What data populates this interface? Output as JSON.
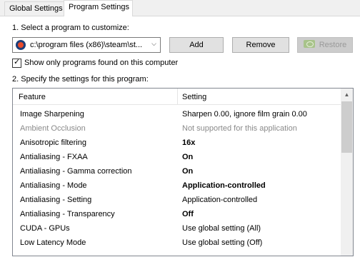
{
  "tabs": [
    {
      "label": "Global Settings"
    },
    {
      "label": "Program Settings"
    }
  ],
  "step1": {
    "label": "1. Select a program to customize:",
    "selected_program": "c:\\program files (x86)\\steam\\st...",
    "add_label": "Add",
    "remove_label": "Remove",
    "restore_label": "Restore"
  },
  "show_only_found": {
    "label": "Show only programs found on this computer",
    "checked": true
  },
  "step2": {
    "label": "2. Specify the settings for this program:"
  },
  "grid": {
    "columns": {
      "feature": "Feature",
      "setting": "Setting"
    },
    "rows": [
      {
        "feature": "Image Sharpening",
        "setting": "Sharpen 0.00, ignore film grain 0.00"
      },
      {
        "feature": "Ambient Occlusion",
        "setting": "Not supported for this application"
      },
      {
        "feature": "Anisotropic filtering",
        "setting": "16x"
      },
      {
        "feature": "Antialiasing - FXAA",
        "setting": "On"
      },
      {
        "feature": "Antialiasing - Gamma correction",
        "setting": "On"
      },
      {
        "feature": "Antialiasing - Mode",
        "setting": "Application-controlled"
      },
      {
        "feature": "Antialiasing - Setting",
        "setting": "Application-controlled"
      },
      {
        "feature": "Antialiasing - Transparency",
        "setting": "Off"
      },
      {
        "feature": "CUDA - GPUs",
        "setting": "Use global setting (All)"
      },
      {
        "feature": "Low Latency Mode",
        "setting": "Use global setting (Off)"
      }
    ]
  },
  "icons": {
    "program": "steam-program-icon",
    "restore": "nvidia-logo-icon",
    "dropdown": "chevron-down-icon",
    "scroll_up": "scroll-up-arrow-icon"
  },
  "colors": {
    "accent_disabled_text": "#8a8a8a",
    "nvidia_green": "#a8c38a"
  }
}
